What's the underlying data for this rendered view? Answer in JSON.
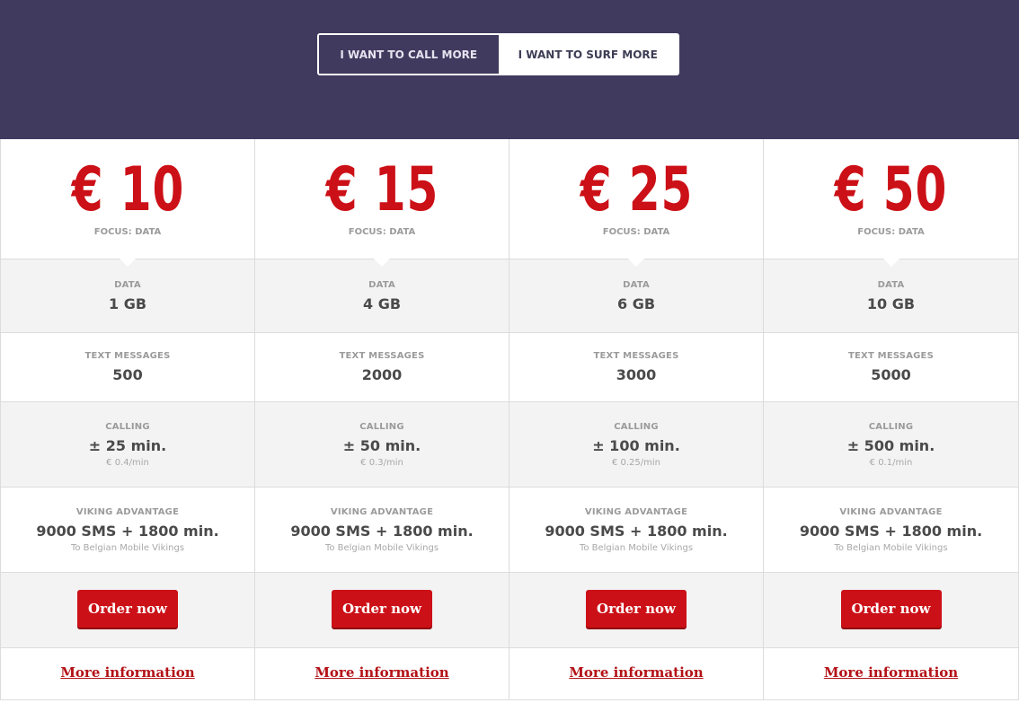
{
  "toggle": {
    "call_label": "I WANT TO CALL MORE",
    "surf_label": "I WANT TO SURF MORE"
  },
  "labels": {
    "focus": "FOCUS: DATA",
    "data": "DATA",
    "text_messages": "TEXT MESSAGES",
    "calling": "CALLING",
    "viking_advantage": "VIKING ADVANTAGE",
    "order": "Order now",
    "more": "More information"
  },
  "plans": [
    {
      "price": "€ 10",
      "data": "1 GB",
      "texts": "500",
      "calling": "± 25 min.",
      "rate": "€ 0.4/min",
      "advantage": "9000 SMS + 1800 min.",
      "advantage_note": "To Belgian Mobile Vikings"
    },
    {
      "price": "€ 15",
      "data": "4 GB",
      "texts": "2000",
      "calling": "± 50 min.",
      "rate": "€ 0.3/min",
      "advantage": "9000 SMS + 1800 min.",
      "advantage_note": "To Belgian Mobile Vikings"
    },
    {
      "price": "€ 25",
      "data": "6 GB",
      "texts": "3000",
      "calling": "± 100 min.",
      "rate": "€ 0.25/min",
      "advantage": "9000 SMS + 1800 min.",
      "advantage_note": "To Belgian Mobile Vikings"
    },
    {
      "price": "€ 50",
      "data": "10 GB",
      "texts": "5000",
      "calling": "± 500 min.",
      "rate": "€ 0.1/min",
      "advantage": "9000 SMS + 1800 min.",
      "advantage_note": "To Belgian Mobile Vikings"
    }
  ],
  "colors": {
    "header_bg": "#413a5f",
    "accent_red": "#cc1017",
    "row_alt": "#f3f3f3"
  }
}
